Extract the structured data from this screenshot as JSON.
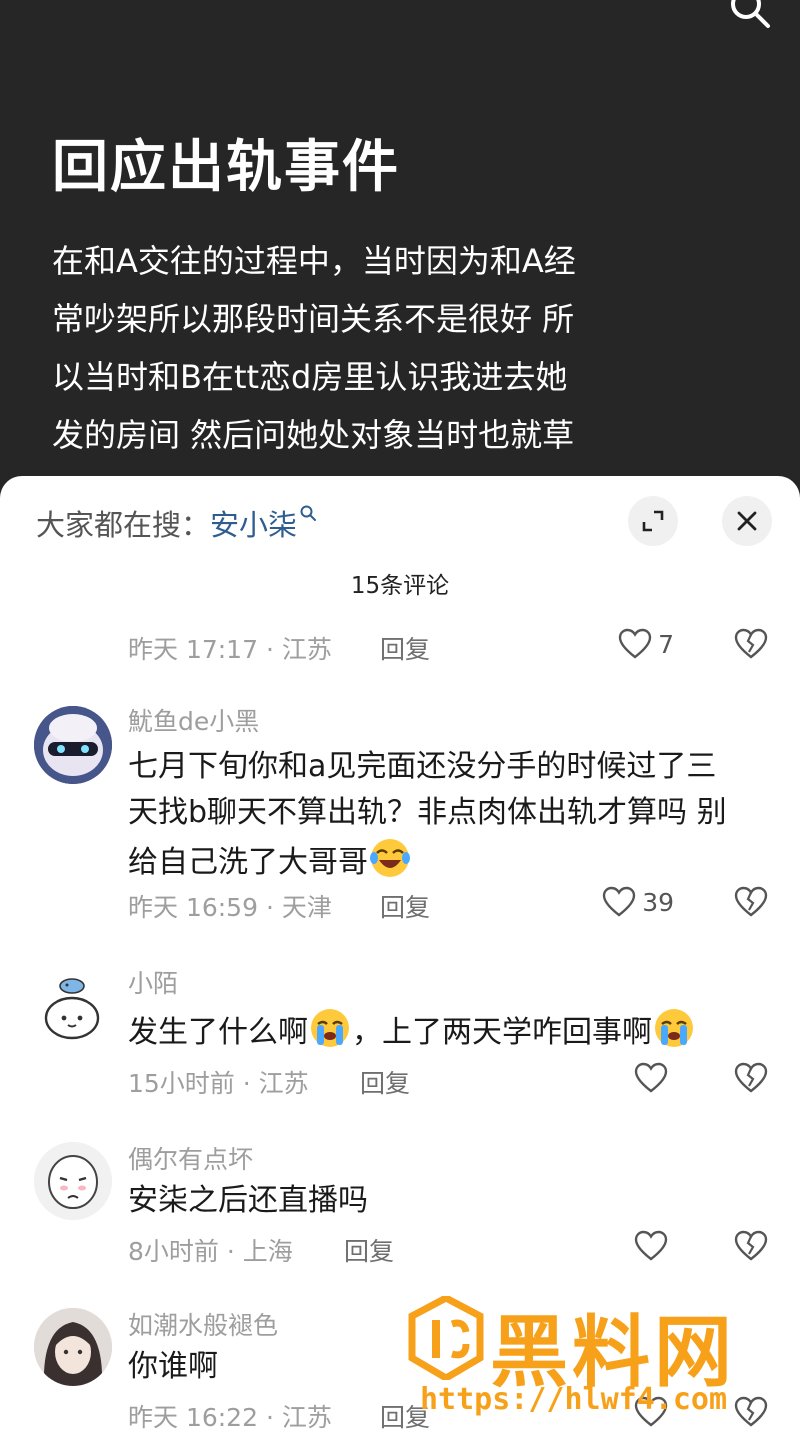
{
  "post": {
    "title": "回应出轨事件",
    "body_lines": [
      "在和A交往的过程中，当时因为和A经",
      "常吵架所以那段时间关系不是很好 所",
      "以当时和B在tt恋d房里认识我进去她",
      "发的房间 然后问她处对象当时也就草"
    ]
  },
  "sheet": {
    "hot_search_label": "大家都在搜：",
    "hot_search_keyword": "安小柒",
    "comment_count": "15条评论",
    "reply_label": "回复"
  },
  "first_meta": {
    "time_loc": "昨天 17:17 · 江苏",
    "likes": "7"
  },
  "comments": [
    {
      "username": "魷鱼de小黑",
      "lines": [
        "七月下旬你和a见完面还没分手的时候过了三",
        "天找b聊天不算出轨？非点肉体出轨才算吗 别",
        "给自己洗了大哥哥"
      ],
      "time_loc": "昨天 16:59 · 天津",
      "likes": "39"
    },
    {
      "username": "小陌",
      "lines": [
        "发生了什么啊",
        "，上了两天学咋回事啊"
      ],
      "time_loc": "15小时前 · 江苏",
      "likes": ""
    },
    {
      "username": "偶尔有点坏",
      "lines": [
        "安柒之后还直播吗"
      ],
      "time_loc": "8小时前 · 上海",
      "likes": ""
    },
    {
      "username": "如潮水般褪色",
      "lines": [
        "你谁啊"
      ],
      "time_loc": "昨天 16:22 · 江苏",
      "likes": ""
    }
  ],
  "watermark": {
    "text": "黑料网",
    "url": "https://hlwf4.com"
  },
  "colors": {
    "post_bg": "#262626",
    "keyword": "#2f5d8f",
    "watermark": "#f7a11a"
  },
  "icons": [
    "search-icon",
    "expand-icon",
    "close-icon",
    "heart-icon",
    "broken-heart-icon",
    "laugh-cry-emoji",
    "crying-emoji"
  ]
}
